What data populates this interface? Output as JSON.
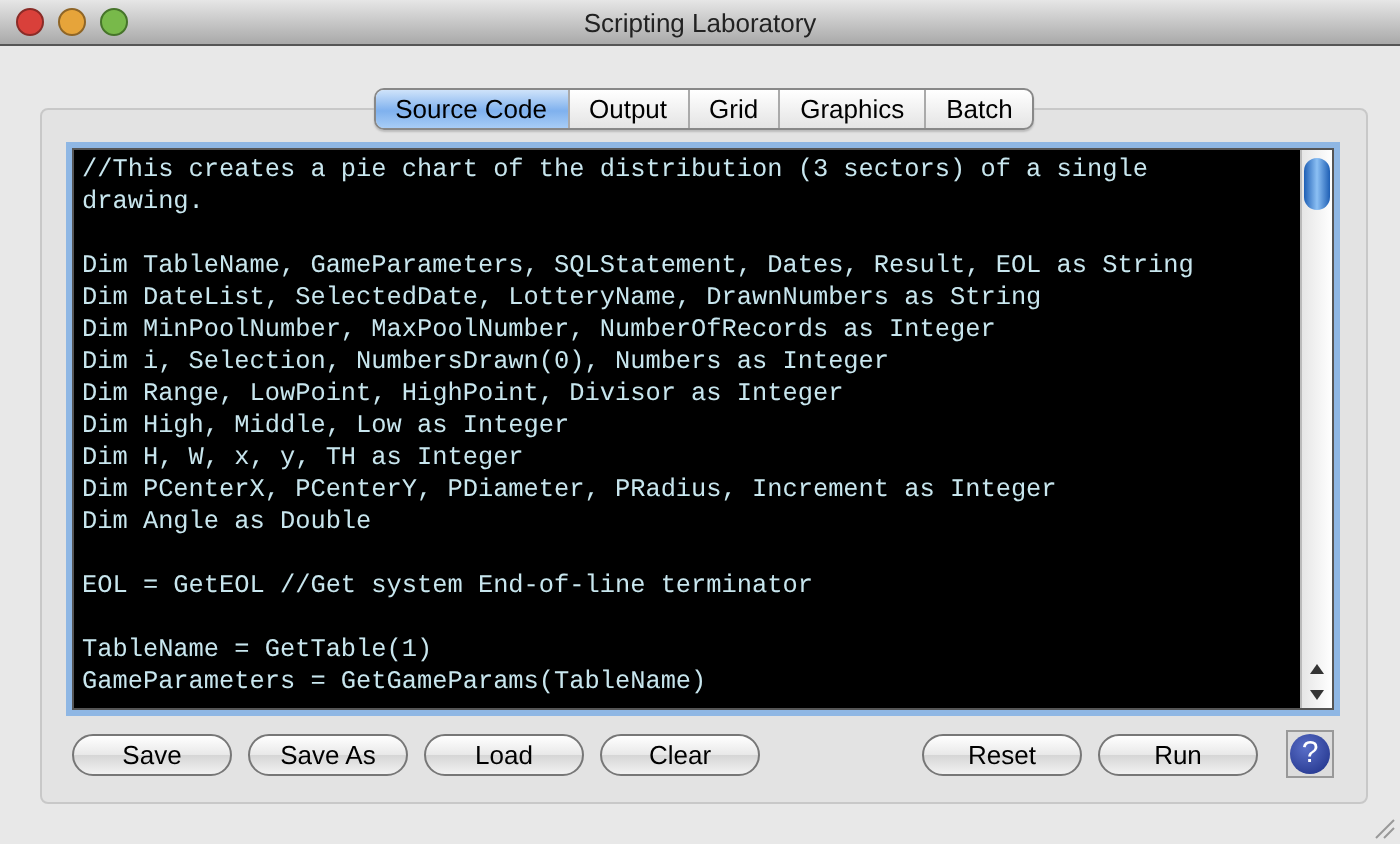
{
  "window": {
    "title": "Scripting Laboratory"
  },
  "tabs": [
    {
      "label": "Source Code",
      "selected": true
    },
    {
      "label": "Output",
      "selected": false
    },
    {
      "label": "Grid",
      "selected": false
    },
    {
      "label": "Graphics",
      "selected": false
    },
    {
      "label": "Batch",
      "selected": false
    }
  ],
  "editor": {
    "blocks": [
      [
        "//This creates a pie chart of the distribution (3 sectors) of a single drawing."
      ],
      [
        "Dim TableName, GameParameters, SQLStatement, Dates, Result, EOL as String",
        "Dim DateList, SelectedDate, LotteryName, DrawnNumbers as String",
        "Dim MinPoolNumber, MaxPoolNumber, NumberOfRecords as Integer",
        "Dim i, Selection, NumbersDrawn(0), Numbers as Integer",
        "Dim Range, LowPoint, HighPoint, Divisor as Integer",
        "Dim High, Middle, Low as Integer",
        "Dim H, W, x, y, TH as Integer",
        "Dim PCenterX, PCenterY, PDiameter, PRadius, Increment as Integer",
        "Dim Angle as Double"
      ],
      [
        "EOL = GetEOL //Get system End-of-line terminator"
      ],
      [
        "TableName = GetTable(1)",
        "GameParameters = GetGameParams(TableName)"
      ]
    ]
  },
  "left_buttons": [
    "Save",
    "Save As",
    "Load",
    "Clear"
  ],
  "right_buttons": [
    "Reset",
    "Run"
  ],
  "help_button": {
    "label": "?"
  }
}
